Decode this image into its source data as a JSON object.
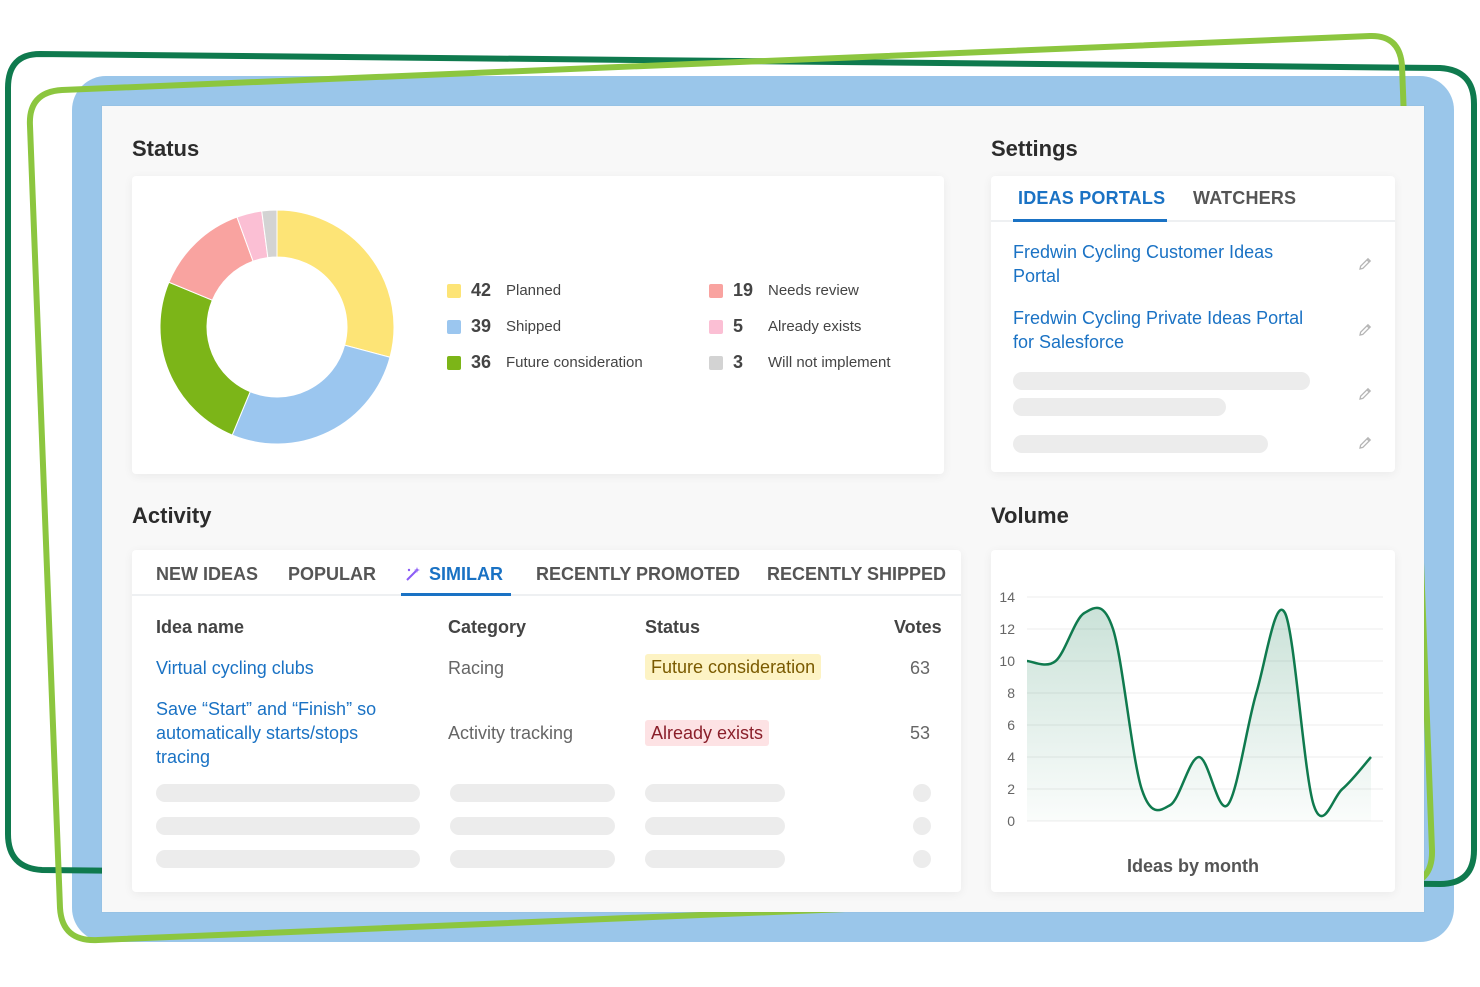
{
  "colors": {
    "accent": "#1a72c4",
    "backdrop": "#9ac6ea",
    "frame_green_dark": "#0f7a4e",
    "frame_green_light": "#8cc63f"
  },
  "status": {
    "title": "Status",
    "legend": [
      {
        "count": "42",
        "label": "Planned",
        "color": "#fde476"
      },
      {
        "count": "39",
        "label": "Shipped",
        "color": "#9bc6ef"
      },
      {
        "count": "36",
        "label": "Future consideration",
        "color": "#7cb518"
      },
      {
        "count": "19",
        "label": "Needs review",
        "color": "#f9a3a0"
      },
      {
        "count": "5",
        "label": "Already exists",
        "color": "#fbbfd4"
      },
      {
        "count": "3",
        "label": "Will not implement",
        "color": "#d3d3d3"
      }
    ]
  },
  "settings": {
    "title": "Settings",
    "tabs": [
      {
        "label": "IDEAS PORTALS",
        "active": true
      },
      {
        "label": "WATCHERS",
        "active": false
      }
    ],
    "portals": [
      "Fredwin Cycling Customer Ideas Portal",
      "Fredwin Cycling Private Ideas Portal for Salesforce"
    ]
  },
  "activity": {
    "title": "Activity",
    "tabs": [
      {
        "label": "NEW IDEAS",
        "active": false
      },
      {
        "label": "POPULAR",
        "active": false
      },
      {
        "label": "SIMILAR",
        "active": true,
        "icon": "magic-wand-icon"
      },
      {
        "label": "RECENTLY PROMOTED",
        "active": false
      },
      {
        "label": "RECENTLY SHIPPED",
        "active": false
      }
    ],
    "columns": {
      "name": "Idea name",
      "category": "Category",
      "status": "Status",
      "votes": "Votes"
    },
    "rows": [
      {
        "name": "Virtual cycling clubs",
        "category": "Racing",
        "status": "Future consideration",
        "votes": "63"
      },
      {
        "name": "Save “Start” and “Finish” so automatically starts/stops tracing",
        "category": "Activity tracking",
        "status": "Already exists",
        "votes": "53"
      }
    ]
  },
  "volume": {
    "title": "Volume",
    "caption": "Ideas by month"
  },
  "chart_data": [
    {
      "type": "pie",
      "categories": [
        "Planned",
        "Shipped",
        "Future consideration",
        "Needs review",
        "Already exists",
        "Will not implement"
      ],
      "values": [
        42,
        39,
        36,
        19,
        5,
        3
      ],
      "colors": [
        "#fde476",
        "#9bc6ef",
        "#7cb518",
        "#f9a3a0",
        "#fbbfd4",
        "#d3d3d3"
      ],
      "title": ""
    },
    {
      "type": "area",
      "title": "Ideas by month",
      "x": [
        0,
        1,
        2,
        3,
        4,
        5,
        6,
        7,
        8,
        9,
        10,
        11,
        12
      ],
      "values": [
        10,
        10,
        13,
        12,
        2,
        1,
        4,
        1,
        8,
        13,
        1,
        2,
        4
      ],
      "ylim": [
        0,
        14
      ],
      "yticks": [
        0,
        2,
        4,
        6,
        8,
        10,
        12,
        14
      ],
      "grid": true,
      "xlabel": "",
      "ylabel": ""
    }
  ]
}
